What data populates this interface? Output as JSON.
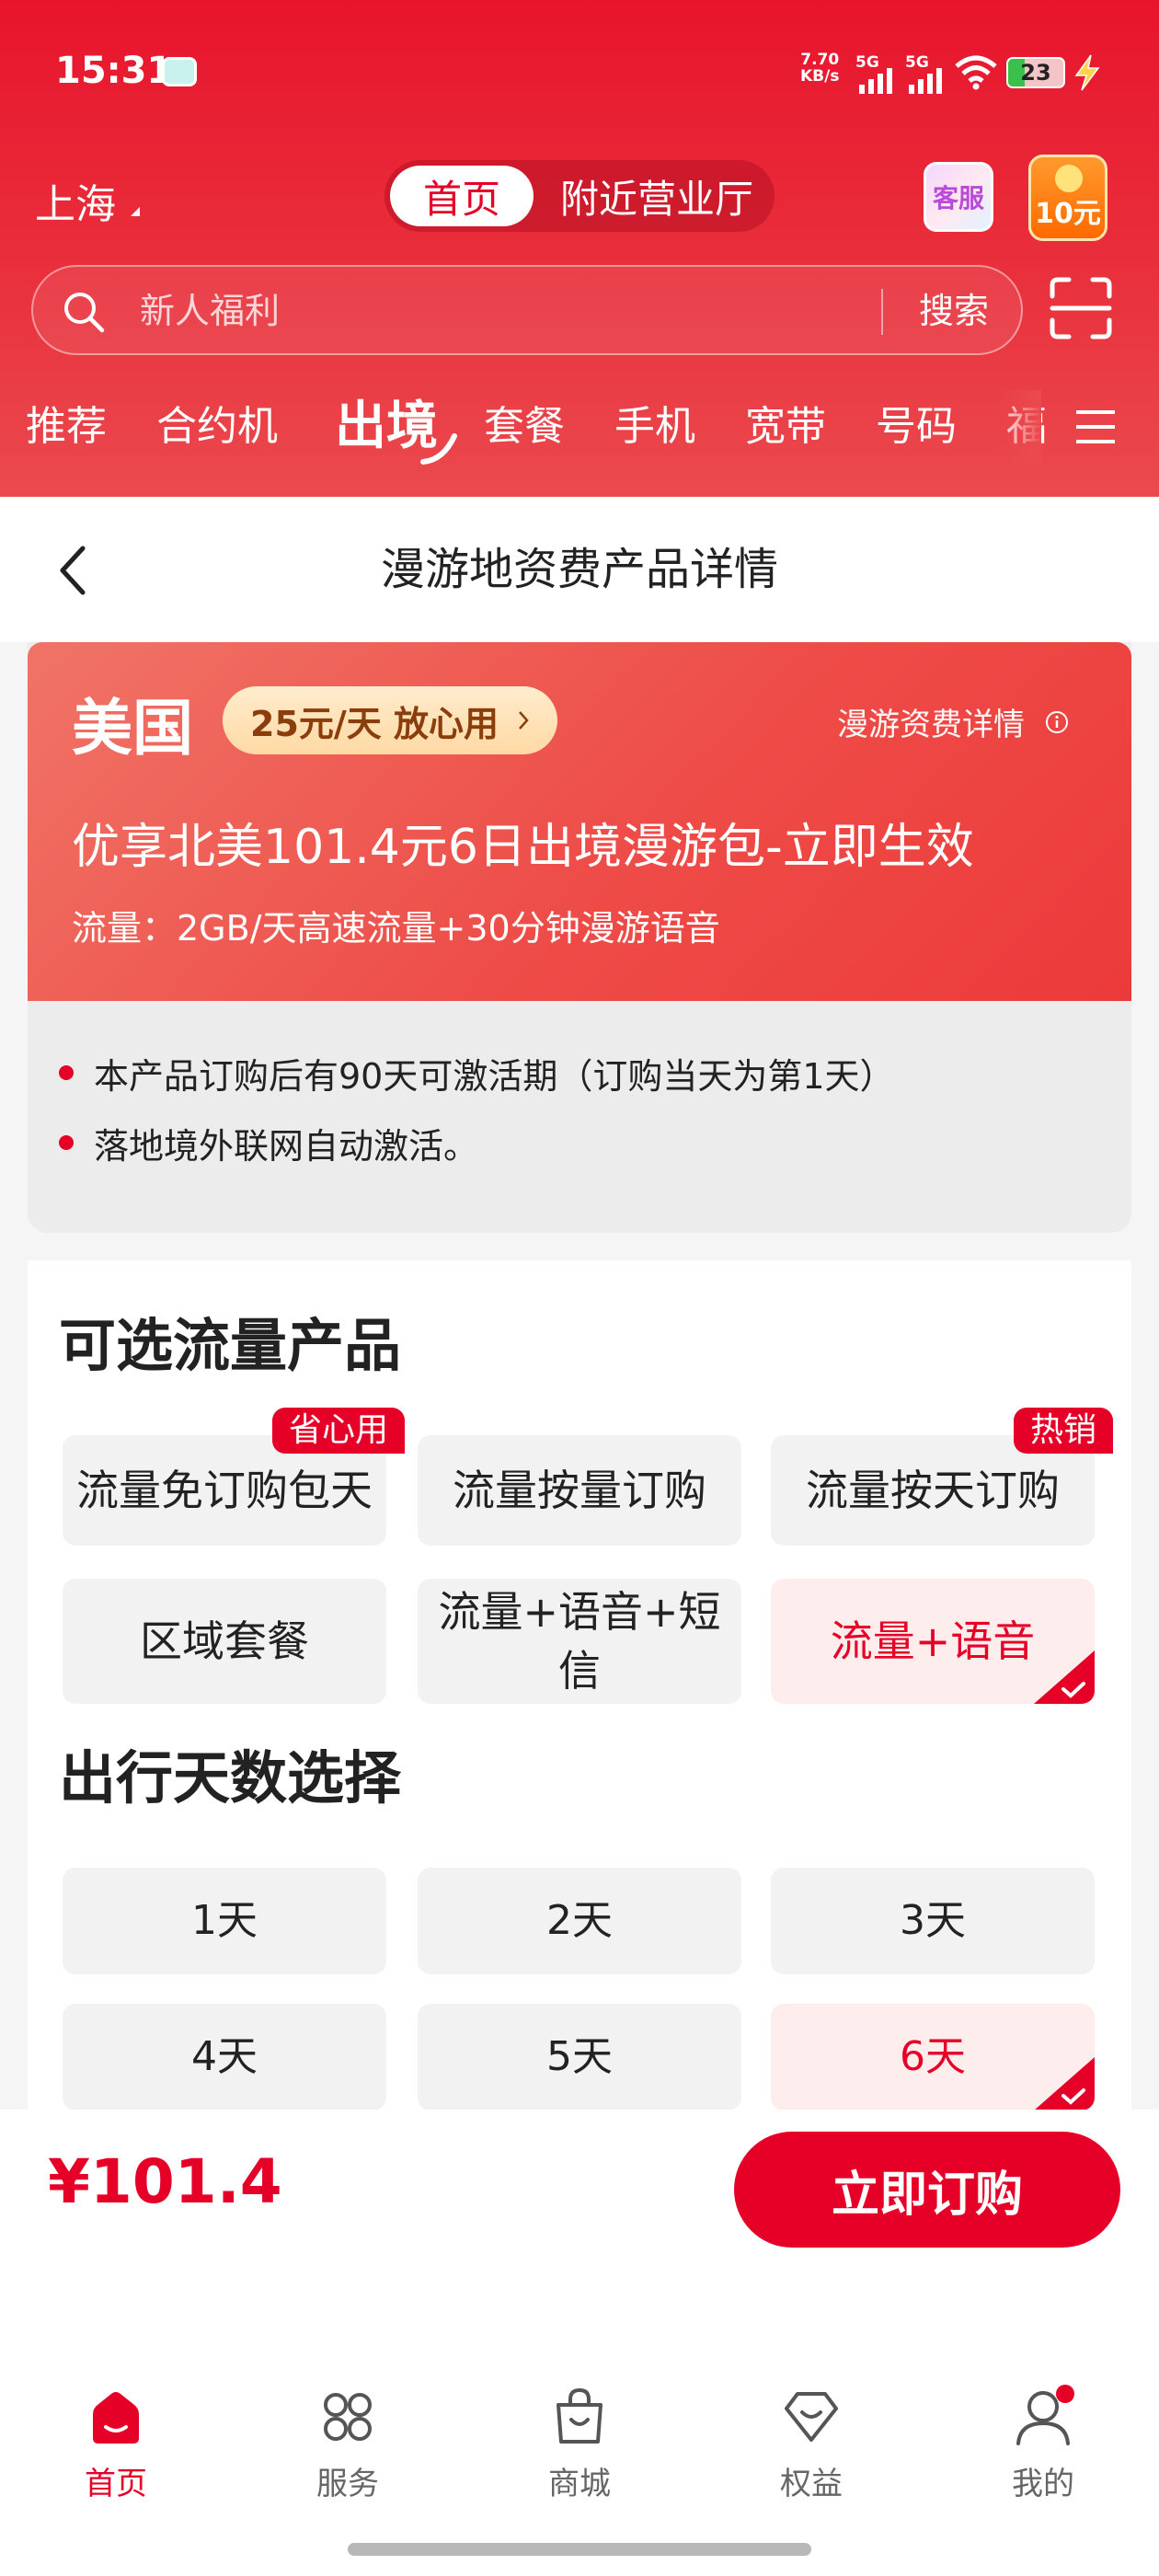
{
  "status_bar": {
    "time": "15:31",
    "net_speed_value": "7.70",
    "net_speed_unit": "KB/s",
    "sim1_label": "5G",
    "sim2_label": "5G",
    "battery_level": "23"
  },
  "header": {
    "city": "上海",
    "segment": {
      "active": "首页",
      "inactive": "附近营业厅"
    },
    "service_label": "客服",
    "coupon_label": "10元",
    "search_placeholder": "新人福利",
    "search_button": "搜索",
    "categories": [
      "推荐",
      "合约机",
      "出境",
      "套餐",
      "手机",
      "宽带",
      "号码",
      "福"
    ],
    "active_category": "出境"
  },
  "nav": {
    "title": "漫游地资费产品详情"
  },
  "product": {
    "country": "美国",
    "daily_tag": "25元/天 放心用",
    "fee_link": "漫游资费详情",
    "name": "优享北美101.4元6日出境漫游包-立即生效",
    "flow": "流量：2GB/天高速流量+30分钟漫游语音",
    "notes": [
      "本产品订购后有90天可激活期（订购当天为第1天）",
      "落地境外联网自动激活。"
    ]
  },
  "flow_products": {
    "title": "可选流量产品",
    "options": [
      {
        "label": "流量免订购包天",
        "ribbon": "省心用",
        "selected": false
      },
      {
        "label": "流量按量订购",
        "ribbon": "",
        "selected": false
      },
      {
        "label": "流量按天订购",
        "ribbon": "热销",
        "selected": false
      },
      {
        "label": "区域套餐",
        "ribbon": "",
        "selected": false
      },
      {
        "label": "流量+语音+短信",
        "ribbon": "",
        "selected": false
      },
      {
        "label": "流量+语音",
        "ribbon": "",
        "selected": true
      }
    ]
  },
  "days": {
    "title": "出行天数选择",
    "options": [
      {
        "label": "1天",
        "selected": false
      },
      {
        "label": "2天",
        "selected": false
      },
      {
        "label": "3天",
        "selected": false
      },
      {
        "label": "4天",
        "selected": false
      },
      {
        "label": "5天",
        "selected": false
      },
      {
        "label": "6天",
        "selected": true
      }
    ]
  },
  "order": {
    "price": "¥101.4",
    "button": "立即订购"
  },
  "tabbar": {
    "tabs": [
      {
        "label": "首页",
        "icon": "home-icon",
        "active": true
      },
      {
        "label": "服务",
        "icon": "grid-icon",
        "active": false
      },
      {
        "label": "商城",
        "icon": "shopping-bag-icon",
        "active": false
      },
      {
        "label": "权益",
        "icon": "heart-badge-icon",
        "active": false
      },
      {
        "label": "我的",
        "icon": "user-icon",
        "active": false
      }
    ]
  },
  "colors": {
    "brand": "#e60027",
    "banner": "#ee4c48",
    "tag": "#ffe2b8"
  }
}
